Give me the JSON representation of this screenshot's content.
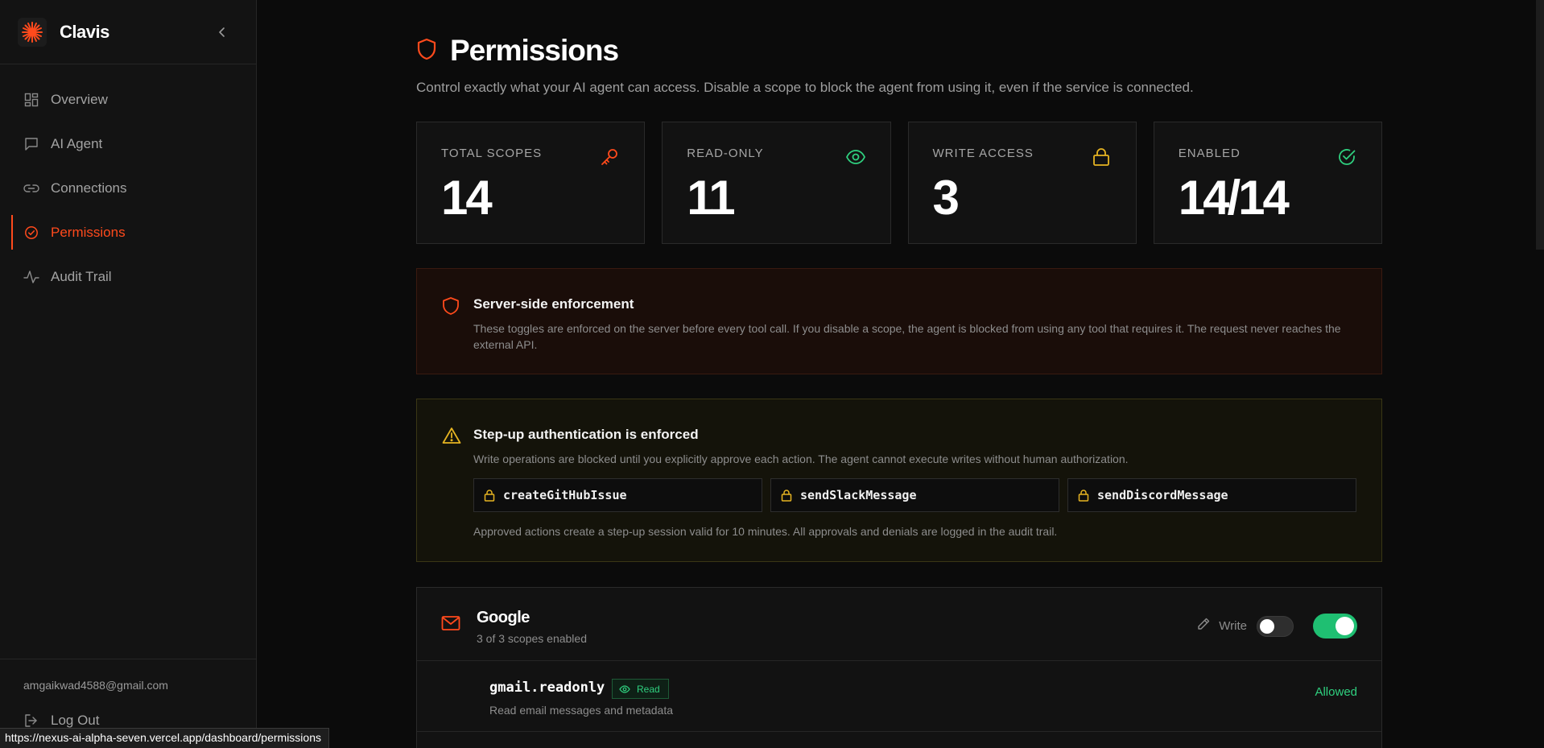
{
  "app": {
    "name": "Clavis",
    "accent": "#ff4a1c"
  },
  "sidebar": {
    "items": [
      {
        "label": "Overview",
        "icon": "grid-icon"
      },
      {
        "label": "AI Agent",
        "icon": "chat-icon"
      },
      {
        "label": "Connections",
        "icon": "link-icon"
      },
      {
        "label": "Permissions",
        "icon": "shield-check-icon",
        "active": true
      },
      {
        "label": "Audit Trail",
        "icon": "activity-icon"
      }
    ],
    "user_email": "amgaikwad4588@gmail.com",
    "logout_label": "Log Out"
  },
  "page": {
    "title": "Permissions",
    "subtitle": "Control exactly what your AI agent can access. Disable a scope to block the agent from using it, even if the service is connected."
  },
  "stats": [
    {
      "label": "TOTAL SCOPES",
      "value": "14",
      "icon": "key-icon",
      "color": "#ff4a1c"
    },
    {
      "label": "READ-ONLY",
      "value": "11",
      "icon": "eye-icon",
      "color": "#2fd07f"
    },
    {
      "label": "WRITE ACCESS",
      "value": "3",
      "icon": "lock-icon",
      "color": "#e6b422"
    },
    {
      "label": "ENABLED",
      "value": "14/14",
      "icon": "check-circle-icon",
      "color": "#2fd07f"
    }
  ],
  "enforcement": {
    "title": "Server-side enforcement",
    "description": "These toggles are enforced on the server before every tool call. If you disable a scope, the agent is blocked from using any tool that requires it. The request never reaches the external API."
  },
  "stepup": {
    "title": "Step-up authentication is enforced",
    "description": "Write operations are blocked until you explicitly approve each action. The agent cannot execute writes without human authorization.",
    "actions": [
      "createGitHubIssue",
      "sendSlackMessage",
      "sendDiscordMessage"
    ],
    "note": "Approved actions create a step-up session valid for 10 minutes. All approvals and denials are logged in the audit trail."
  },
  "services": [
    {
      "name": "Google",
      "count_text": "3 of 3 scopes enabled",
      "write_label": "Write",
      "scopes": [
        {
          "name": "gmail.readonly",
          "badge": "Read",
          "description": "Read email messages and metadata",
          "status": "Allowed"
        }
      ]
    }
  ],
  "status_url": "https://nexus-ai-alpha-seven.vercel.app/dashboard/permissions"
}
